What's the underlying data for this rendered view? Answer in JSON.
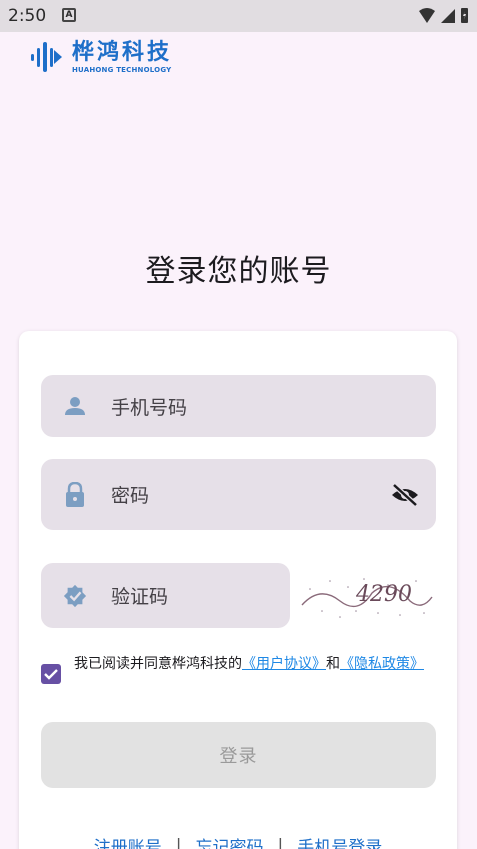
{
  "status_bar": {
    "time": "2:50",
    "notification_letter": "A"
  },
  "brand": {
    "name_cn": "桦鸿科技",
    "name_en": "HUAHONG TECHNOLOGY",
    "color": "#1e6fc9"
  },
  "page_title": "登录您的账号",
  "form": {
    "phone_placeholder": "手机号码",
    "password_placeholder": "密码",
    "code_placeholder": "验证码",
    "captcha_text": "4290",
    "agreement": {
      "checked": true,
      "prefix": "我已阅读并同意桦鸿科技的",
      "user_agreement": "《用户协议》",
      "connector": "和",
      "privacy_policy": "《隐私政策》"
    },
    "login_label": "登录"
  },
  "links": {
    "register": "注册账号",
    "forgot": "忘记密码",
    "phone_login": "手机号登录",
    "separator": "|"
  },
  "colors": {
    "accent": "#6750a4",
    "icon": "#7c9ec2",
    "field_bg": "#e6e0e8"
  }
}
